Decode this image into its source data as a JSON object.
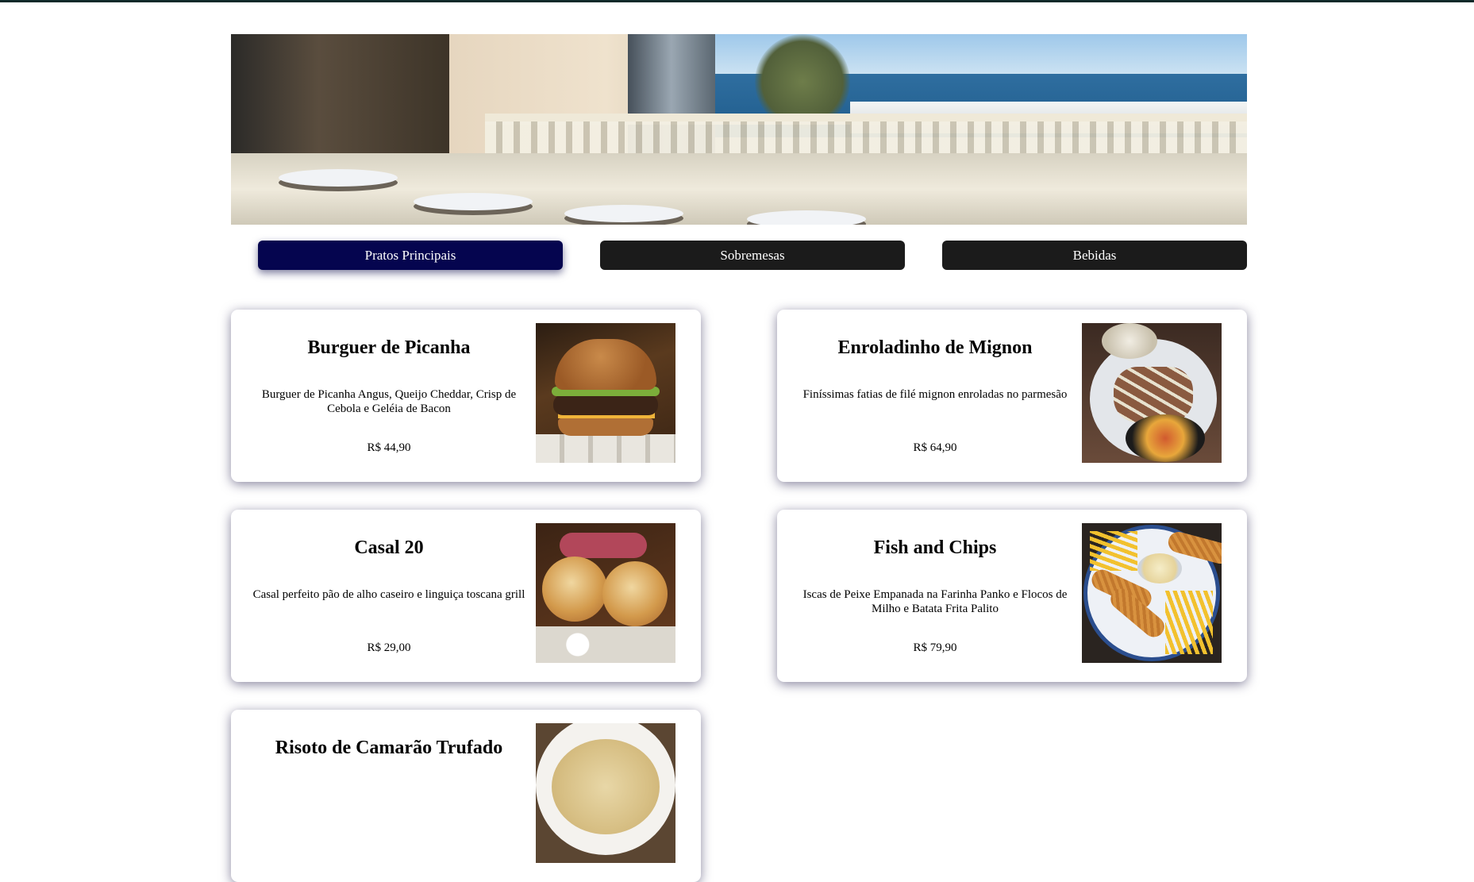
{
  "banner": {
    "alt": "restaurant-terrace-photo"
  },
  "tabs": [
    {
      "label": "Pratos Principais",
      "active": true
    },
    {
      "label": "Sobremesas",
      "active": false
    },
    {
      "label": "Bebidas",
      "active": false
    }
  ],
  "colors": {
    "tab_active": "#05054f",
    "tab_inactive": "#1b1b1b",
    "top_rule": "#0f2a2a"
  },
  "menu": {
    "items": [
      {
        "name": "Burguer de Picanha",
        "description": "Burguer de Picanha Angus, Queijo Cheddar, Crisp de Cebola e Geléia de Bacon",
        "price": "R$ 44,90",
        "photo": "burger-photo"
      },
      {
        "name": "Enroladinho de Mignon",
        "description": "Finíssimas fatias de filé mignon enroladas no parmesão",
        "price": "R$ 64,90",
        "photo": "mignon-roll-photo"
      },
      {
        "name": "Casal 20",
        "description": "Casal perfeito pão de alho caseiro e linguiça toscana grill",
        "price": "R$ 29,00",
        "photo": "garlic-bread-sausage-photo"
      },
      {
        "name": "Fish and Chips",
        "description": "Iscas de Peixe Empanada na Farinha Panko e Flocos de Milho e Batata Frita Palito",
        "price": "R$ 79,90",
        "photo": "fish-and-chips-photo"
      },
      {
        "name": "Risoto de Camarão Trufado",
        "description": "",
        "price": "",
        "photo": "shrimp-risotto-photo"
      }
    ]
  }
}
